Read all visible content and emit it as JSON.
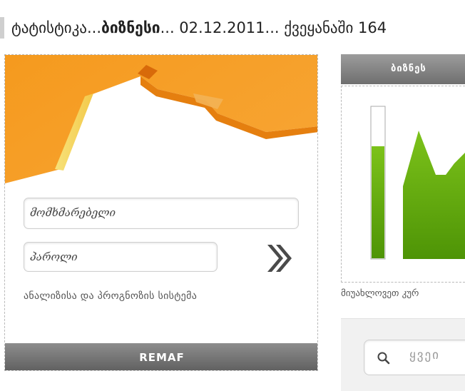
{
  "ticker": {
    "prefix": "ტატისტიკა...",
    "bold": "ბიზნესი",
    "suffix": "... 02.12.2011... ქვეყანაში 164"
  },
  "login": {
    "username_placeholder": "მომხმარებელი",
    "password_placeholder": "პაროლი",
    "tagline": "ანალიზისა და პროგნოზის სისტემა",
    "footer": "REMAF"
  },
  "business": {
    "header": "ბიზნეს",
    "caption": "მიუახლოვეთ კურ"
  },
  "search": {
    "placeholder": "ყვეი"
  },
  "colors": {
    "orange": "#F7941E",
    "green": "#5AA60A",
    "gray_bar": "#6F6F6F"
  },
  "icons": [
    "submit-arrow-icon",
    "search-icon"
  ]
}
